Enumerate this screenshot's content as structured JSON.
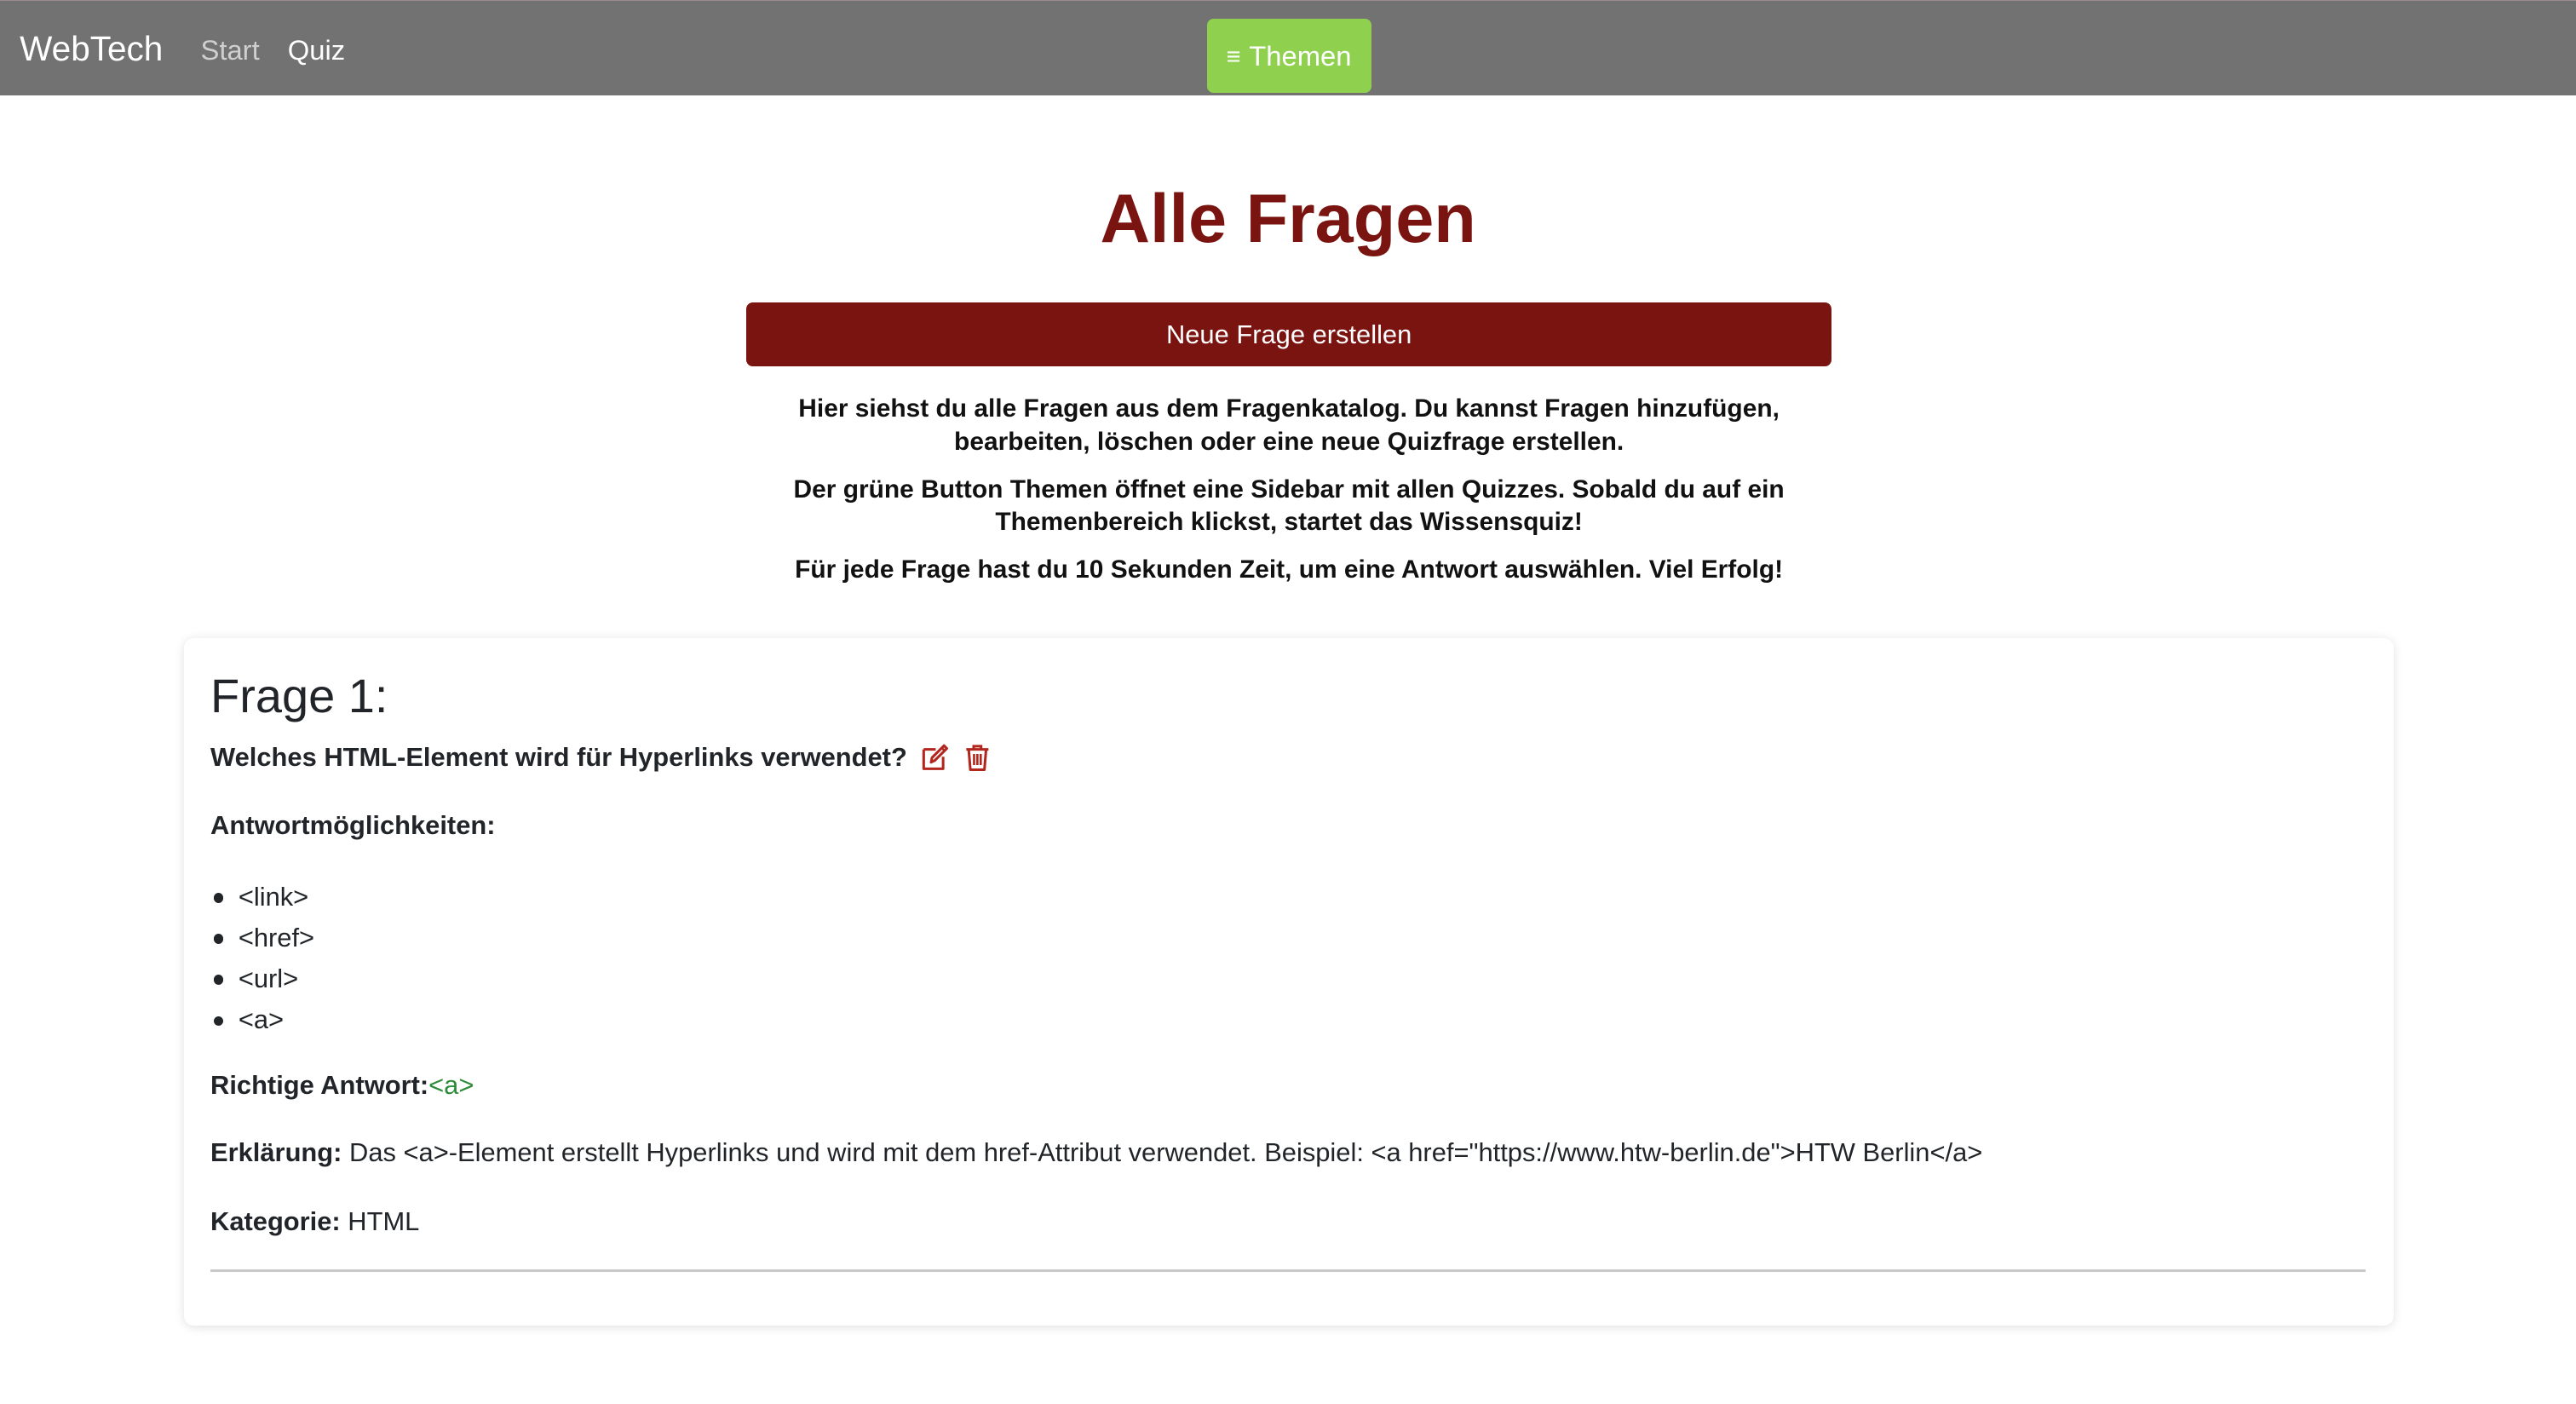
{
  "navbar": {
    "brand": "WebTech",
    "links": [
      {
        "label": "Start",
        "active": false
      },
      {
        "label": "Quiz",
        "active": true
      }
    ],
    "themen_button": {
      "icon": "hamburger-menu-icon",
      "icon_glyph": "≡",
      "label": "Themen"
    },
    "background_color": "#727272",
    "button_color": "#8fd14f"
  },
  "main": {
    "title": "Alle Fragen",
    "new_question_button": "Neue Frage erstellen",
    "intro": [
      "Hier siehst du alle Fragen aus dem Fragenkatalog. Du kannst Fragen hinzufügen, bearbeiten, löschen oder eine neue Quizfrage erstellen.",
      "Der grüne Button Themen öffnet eine Sidebar mit allen Quizzes. Sobald du auf ein Themenbereich klickst, startet das Wissensquiz!",
      "Für jede Frage hast du 10 Sekunden Zeit, um eine Antwort auswählen. Viel Erfolg!"
    ],
    "accent_color": "#7a1410"
  },
  "questions": [
    {
      "heading": "Frage 1:",
      "text": "Welches HTML-Element wird für Hyperlinks verwendet?",
      "edit_icon": "edit-icon",
      "delete_icon": "trash-icon",
      "answers_label": "Antwortmöglichkeiten:",
      "answers": [
        "<link>",
        "<href>",
        "<url>",
        "<a>"
      ],
      "correct_label": "Richtige Antwort:",
      "correct_answer": "<a>",
      "explanation_label": "Erklärung:",
      "explanation": "Das <a>-Element erstellt Hyperlinks und wird mit dem href-Attribut verwendet. Beispiel: <a href=\"https://www.htw-berlin.de\">HTW Berlin</a>",
      "category_label": "Kategorie:",
      "category": "HTML",
      "correct_color": "#2e8b3a"
    }
  ]
}
